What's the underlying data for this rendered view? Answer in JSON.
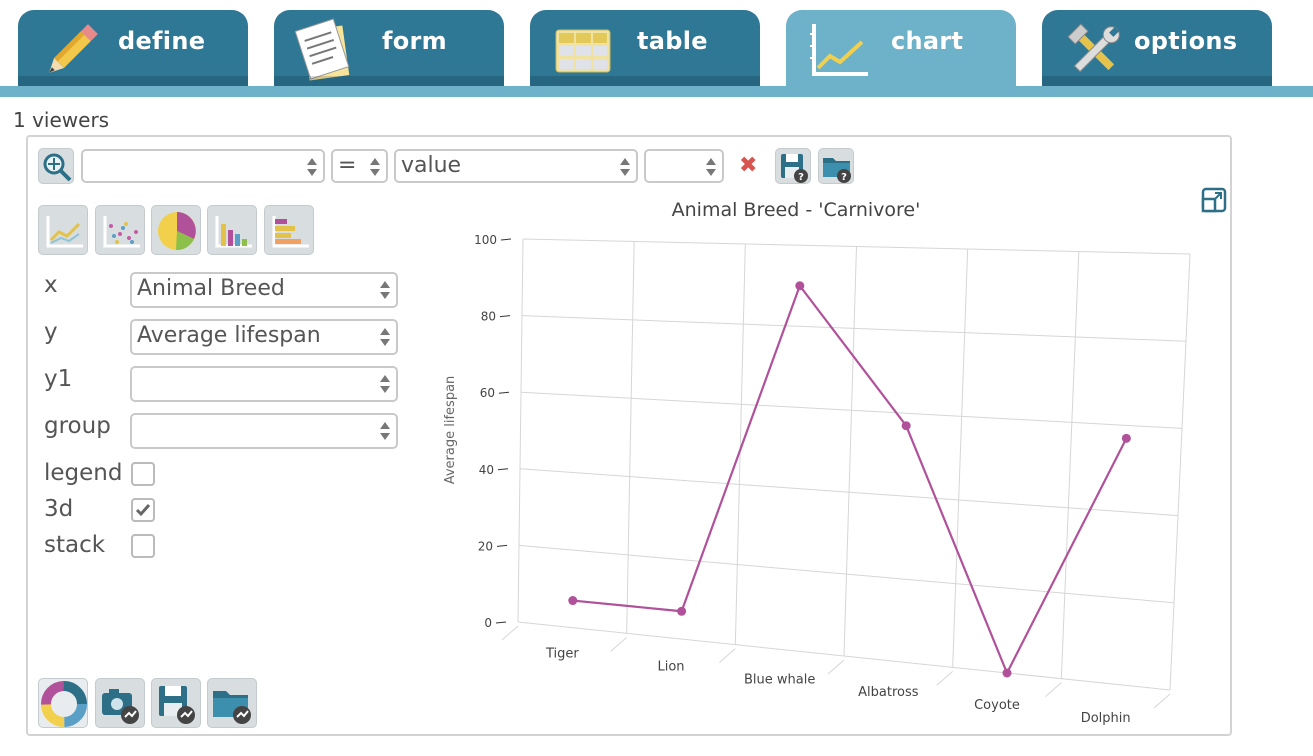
{
  "tabs": [
    {
      "label": "define",
      "icon": "pencil-icon",
      "active": false
    },
    {
      "label": "form",
      "icon": "form-icon",
      "active": false
    },
    {
      "label": "table",
      "icon": "table-icon",
      "active": false
    },
    {
      "label": "chart",
      "icon": "line-chart-icon",
      "active": true
    },
    {
      "label": "options",
      "icon": "tools-icon",
      "active": false
    }
  ],
  "viewers": "1 viewers",
  "filter": {
    "field": "",
    "operator": "=",
    "value_mode": "value",
    "value": ""
  },
  "chart_types": [
    "line-chart-icon",
    "scatter-chart-icon",
    "pie-chart-icon",
    "bar-chart-icon",
    "horizontal-bar-chart-icon"
  ],
  "config": {
    "x_label": "x",
    "x_value": "Animal Breed",
    "y_label": "y",
    "y_value": "Average lifespan",
    "y1_label": "y1",
    "y1_value": "",
    "group_label": "group",
    "group_value": "",
    "legend_label": "legend",
    "legend_checked": false,
    "threed_label": "3d",
    "threed_checked": true,
    "stack_label": "stack",
    "stack_checked": false
  },
  "colors": {
    "tab": "#2e7795",
    "tab_active": "#6eb2c9",
    "series": "#b0519a"
  },
  "chart_data": {
    "type": "line",
    "title": "Animal Breed - 'Carnivore'",
    "xlabel": "",
    "ylabel": "Average lifespan",
    "categories": [
      "Tiger",
      "Lion",
      "Blue whale",
      "Albatross",
      "Coyote",
      "Dolphin"
    ],
    "series": [
      {
        "values": [
          7,
          7,
          90,
          57,
          0,
          57
        ]
      }
    ],
    "ylim": [
      0,
      100
    ],
    "yticks": [
      0,
      20,
      40,
      60,
      80,
      100
    ],
    "ytick_labels": [
      "0",
      "20",
      "40",
      "60",
      "80",
      "100"
    ],
    "grid": true,
    "three_d": true
  }
}
